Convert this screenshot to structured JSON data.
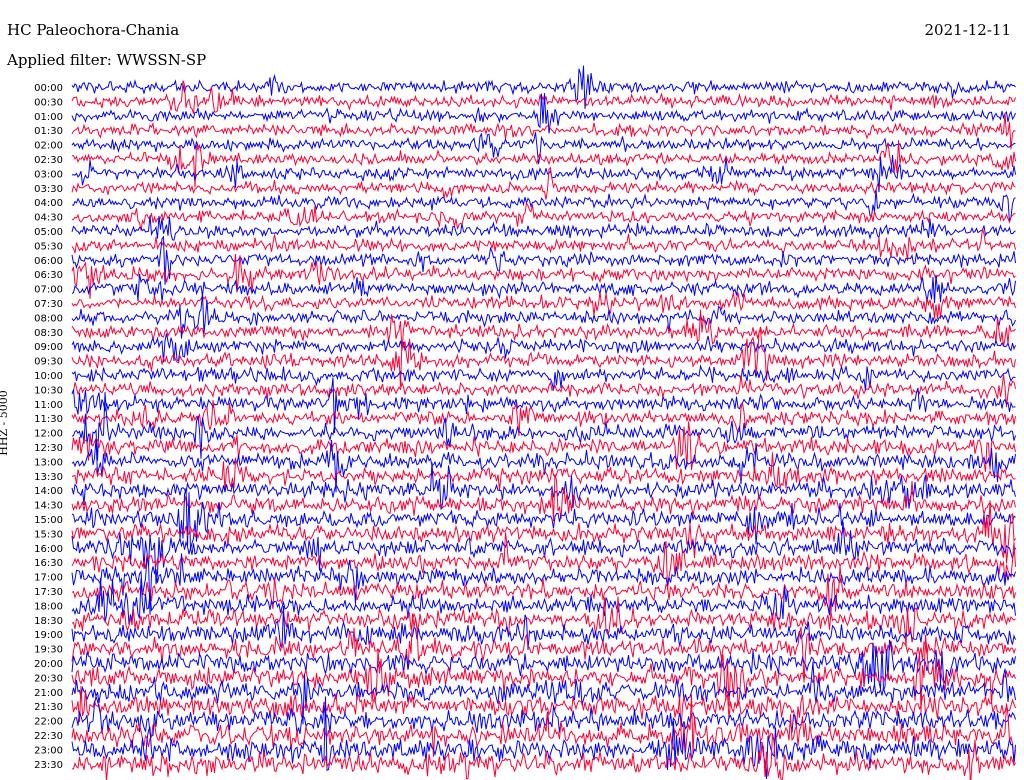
{
  "header": {
    "station": "HC Paleochora-Chania",
    "date": "2021-12-11",
    "filter": "Applied filter: WWSSN-SP",
    "channel": "HHZ - 5000"
  },
  "chart_data": {
    "type": "line",
    "subtype": "helicorder",
    "row_labels": [
      "00:00",
      "00:30",
      "01:00",
      "01:30",
      "02:00",
      "02:30",
      "03:00",
      "03:30",
      "04:00",
      "04:30",
      "05:00",
      "05:30",
      "06:00",
      "06:30",
      "07:00",
      "07:30",
      "08:00",
      "08:30",
      "09:00",
      "09:30",
      "10:00",
      "10:30",
      "11:00",
      "11:30",
      "12:00",
      "12:30",
      "13:00",
      "13:30",
      "14:00",
      "14:30",
      "15:00",
      "15:30",
      "16:00",
      "16:30",
      "17:00",
      "17:30",
      "18:00",
      "18:30",
      "19:00",
      "19:30",
      "20:00",
      "20:30",
      "21:00",
      "21:30",
      "22:00",
      "22:30",
      "23:00",
      "23:30"
    ],
    "trace_colors": [
      "#0000ff",
      "#ff0033"
    ],
    "background": "#ffffff",
    "relative_amplitude_by_hour": [
      0.3,
      0.3,
      0.3,
      0.3,
      0.32,
      0.35,
      0.4,
      0.42,
      0.45,
      0.45,
      0.48,
      0.5,
      0.55,
      0.6,
      0.65,
      0.7,
      0.72,
      0.75,
      0.8,
      0.85,
      0.9,
      0.95,
      1.0,
      1.05
    ]
  }
}
